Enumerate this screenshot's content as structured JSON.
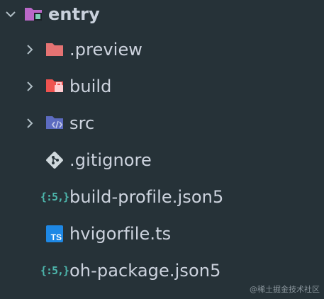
{
  "explorer": {
    "root": {
      "label": "entry",
      "icon": "folder-open-icon",
      "expanded": true
    },
    "items": [
      {
        "label": ".preview",
        "icon": "folder-icon",
        "type": "folder",
        "expanded": false
      },
      {
        "label": "build",
        "icon": "folder-build-icon",
        "type": "folder",
        "expanded": false
      },
      {
        "label": "src",
        "icon": "folder-src-icon",
        "type": "folder",
        "expanded": false
      },
      {
        "label": ".gitignore",
        "icon": "git-icon",
        "type": "file"
      },
      {
        "label": "build-profile.json5",
        "icon": "json5-icon",
        "type": "file",
        "icon_text": "{:5,}"
      },
      {
        "label": "hvigorfile.ts",
        "icon": "typescript-icon",
        "type": "file",
        "icon_text": "TS"
      },
      {
        "label": "oh-package.json5",
        "icon": "json5-icon",
        "type": "file",
        "icon_text": "{:5,}"
      }
    ]
  },
  "watermark": "@稀土掘金技术社区",
  "colors": {
    "background": "#263238",
    "text": "#cdd3de",
    "root_folder": "#ba68c8",
    "preview_folder": "#e57373",
    "build_folder": "#ef5350",
    "src_folder": "#5c6bc0",
    "git": "#cfd8dc",
    "json5": "#4db6ac",
    "typescript": "#1e88e5"
  }
}
